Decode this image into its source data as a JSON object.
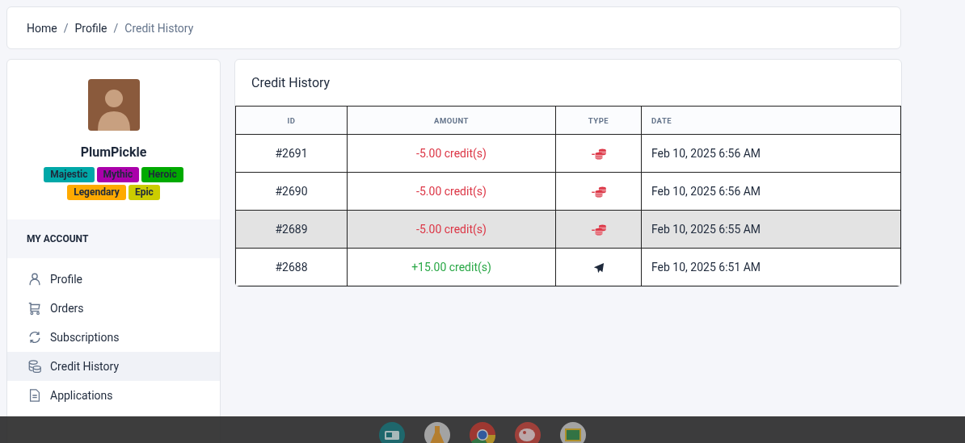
{
  "breadcrumb": [
    {
      "label": "Home",
      "current": false
    },
    {
      "separator_before": "/",
      "label": "Profile",
      "current": false
    },
    {
      "separator_before": "/",
      "label": "Credit History",
      "current": true
    }
  ],
  "profile": {
    "username": "PlumPickle",
    "badges": [
      {
        "label": "Majestic",
        "color": "#00a8a8"
      },
      {
        "label": "Mythic",
        "color": "#aa00aa"
      },
      {
        "label": "Heroic",
        "color": "#00aa00"
      },
      {
        "label": "Legendary",
        "color": "#ffaa00"
      },
      {
        "label": "Epic",
        "color": "#cccc00"
      }
    ]
  },
  "sidebar": {
    "section": "MY ACCOUNT",
    "items": [
      {
        "label": "Profile",
        "kind": "user",
        "selected": false
      },
      {
        "label": "Orders",
        "kind": "cart",
        "selected": false
      },
      {
        "label": "Subscriptions",
        "kind": "refresh",
        "selected": false
      },
      {
        "label": "Credit History",
        "kind": "coins",
        "selected": true
      },
      {
        "label": "Applications",
        "kind": "document",
        "selected": false
      }
    ]
  },
  "credit_history": {
    "title": "Credit History",
    "columns": [
      "ID",
      "AMOUNT",
      "TYPE",
      "DATE"
    ],
    "rows": [
      {
        "id": "#2691",
        "amount": "-5.00 credit(s)",
        "kind": "debit",
        "date": "Feb 10, 2025 6:56 AM",
        "highlighted": false
      },
      {
        "id": "#2690",
        "amount": "-5.00 credit(s)",
        "kind": "debit",
        "date": "Feb 10, 2025 6:56 AM",
        "highlighted": false
      },
      {
        "id": "#2689",
        "amount": "-5.00 credit(s)",
        "kind": "debit",
        "date": "Feb 10, 2025 6:55 AM",
        "highlighted": true
      },
      {
        "id": "#2688",
        "amount": "+15.00 credit(s)",
        "kind": "credit",
        "date": "Feb 10, 2025 6:51 AM",
        "highlighted": false
      }
    ]
  }
}
